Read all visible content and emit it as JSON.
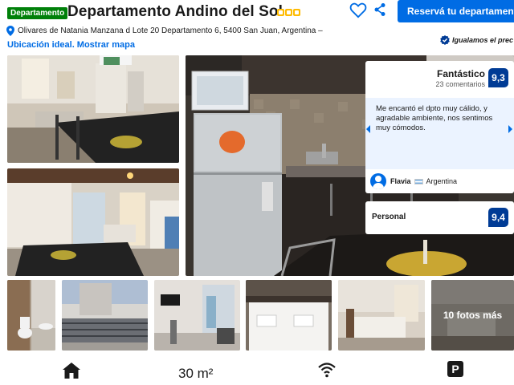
{
  "header": {
    "type_badge": "Departamento",
    "title": "Departamento Andino del Sol",
    "stars": 3,
    "reserve_label": "Reservá tu departamento"
  },
  "location": {
    "address": "Olivares de Natania Manzana d Lote 20 Departamento 6, 5400 San Juan, Argentina –",
    "map_link": "Ubicación ideal. Mostrar mapa",
    "price_match": "Igualamos el prec"
  },
  "review": {
    "label": "Fantástico",
    "count": "23 comentarios",
    "score": "9,3",
    "quote": "Me encantó el dpto muy cálido, y agradable ambiente, nos sentimos muy cómodos.",
    "reviewer_name": "Flavia",
    "reviewer_country": "Argentina"
  },
  "staff": {
    "label": "Personal",
    "score": "9,4"
  },
  "gallery": {
    "more_label": "10 fotos más"
  },
  "facilities": {
    "size": "30 m²",
    "parking_symbol": "P"
  },
  "colors": {
    "brand_blue": "#006ce4",
    "score_navy": "#003b95",
    "badge_green": "#008009",
    "star_yellow": "#febb02"
  }
}
